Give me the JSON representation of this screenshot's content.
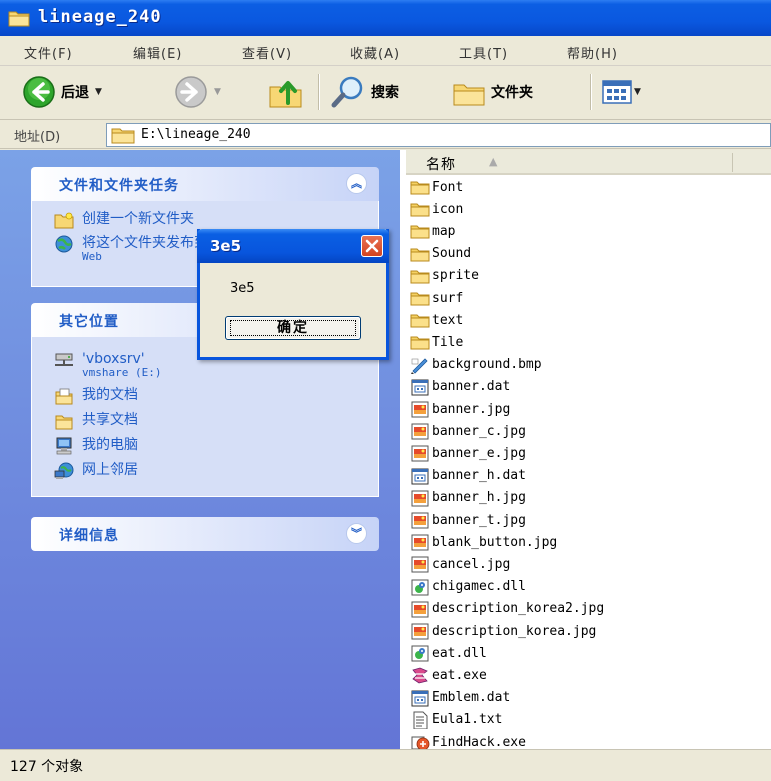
{
  "window": {
    "title": "lineage_240"
  },
  "menu": {
    "items": [
      "文件(F)",
      "编辑(E)",
      "查看(V)",
      "收藏(A)",
      "工具(T)",
      "帮助(H)"
    ]
  },
  "toolbar": {
    "back_label": "后退",
    "search_label": "搜索",
    "folders_label": "文件夹"
  },
  "address": {
    "label": "地址(D)",
    "path": "E:\\lineage_240"
  },
  "taskpane": {
    "file_tasks": {
      "title": "文件和文件夹任务",
      "items": [
        "创建一个新文件夹",
        "将这个文件夹发布到",
        "Web"
      ]
    },
    "other_places": {
      "title": "其它位置",
      "items": [
        {
          "label": "'vboxsrv'",
          "sub": "vmshare (E:)",
          "icon": "network-drive-icon"
        },
        {
          "label": "我的文档",
          "icon": "my-documents-icon"
        },
        {
          "label": "共享文档",
          "icon": "shared-documents-icon"
        },
        {
          "label": "我的电脑",
          "icon": "my-computer-icon"
        },
        {
          "label": "网上邻居",
          "icon": "network-places-icon"
        }
      ]
    },
    "details": {
      "title": "详细信息"
    }
  },
  "filelist": {
    "column_name": "名称",
    "files": [
      {
        "name": "Font",
        "icon": "folder"
      },
      {
        "name": "icon",
        "icon": "folder"
      },
      {
        "name": "map",
        "icon": "folder"
      },
      {
        "name": "Sound",
        "icon": "folder"
      },
      {
        "name": "sprite",
        "icon": "folder"
      },
      {
        "name": "surf",
        "icon": "folder"
      },
      {
        "name": "text",
        "icon": "folder"
      },
      {
        "name": "Tile",
        "icon": "folder"
      },
      {
        "name": "background.bmp",
        "icon": "bmp"
      },
      {
        "name": "banner.dat",
        "icon": "dat"
      },
      {
        "name": "banner.jpg",
        "icon": "jpg"
      },
      {
        "name": "banner_c.jpg",
        "icon": "jpg"
      },
      {
        "name": "banner_e.jpg",
        "icon": "jpg"
      },
      {
        "name": "banner_h.dat",
        "icon": "dat"
      },
      {
        "name": "banner_h.jpg",
        "icon": "jpg"
      },
      {
        "name": "banner_t.jpg",
        "icon": "jpg"
      },
      {
        "name": "blank_button.jpg",
        "icon": "jpg"
      },
      {
        "name": "cancel.jpg",
        "icon": "jpg"
      },
      {
        "name": "chigamec.dll",
        "icon": "dll"
      },
      {
        "name": "description_korea2.jpg",
        "icon": "jpg"
      },
      {
        "name": "description_korea.jpg",
        "icon": "jpg"
      },
      {
        "name": "eat.dll",
        "icon": "dll"
      },
      {
        "name": "eat.exe",
        "icon": "exe"
      },
      {
        "name": "Emblem.dat",
        "icon": "dat"
      },
      {
        "name": "Eula1.txt",
        "icon": "txt"
      },
      {
        "name": "FindHack.exe",
        "icon": "exe2"
      }
    ]
  },
  "status": {
    "text": "127 个对象"
  },
  "dialog": {
    "title": "3e5",
    "message": "3e5",
    "ok_label": "确定"
  },
  "colors": {
    "titlebar": "#0a58e0",
    "taskpane_link": "#215dc6",
    "close_button": "#d3431f",
    "folder": "#f5d164"
  }
}
